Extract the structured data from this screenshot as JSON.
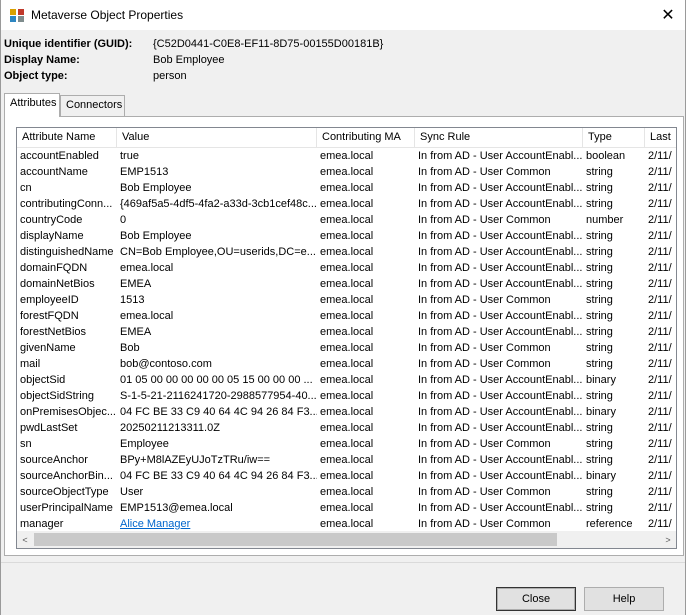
{
  "window": {
    "title": "Metaverse Object Properties",
    "close_glyph": "✕"
  },
  "info": [
    {
      "label": "Unique identifier (GUID):",
      "value": "{C52D0441-C0E8-EF11-8D75-00155D00181B}"
    },
    {
      "label": "Display Name:",
      "value": "Bob Employee"
    },
    {
      "label": "Object type:",
      "value": "person"
    }
  ],
  "tabs": [
    {
      "label": "Attributes",
      "active": true
    },
    {
      "label": "Connectors",
      "active": false
    }
  ],
  "columns": [
    "Attribute Name",
    "Value",
    "Contributing MA",
    "Sync Rule",
    "Type",
    "Last"
  ],
  "rows": [
    [
      "accountEnabled",
      "true",
      "emea.local",
      "In from AD - User AccountEnabl...",
      "boolean",
      "2/11/"
    ],
    [
      "accountName",
      "EMP1513",
      "emea.local",
      "In from AD - User Common",
      "string",
      "2/11/"
    ],
    [
      "cn",
      "Bob Employee",
      "emea.local",
      "In from AD - User AccountEnabl...",
      "string",
      "2/11/"
    ],
    [
      "contributingConn...",
      "{469af5a5-4df5-4fa2-a33d-3cb1cef48c...",
      "emea.local",
      "In from AD - User AccountEnabl...",
      "string",
      "2/11/"
    ],
    [
      "countryCode",
      "0",
      "emea.local",
      "In from AD - User Common",
      "number",
      "2/11/"
    ],
    [
      "displayName",
      "Bob Employee",
      "emea.local",
      "In from AD - User AccountEnabl...",
      "string",
      "2/11/"
    ],
    [
      "distinguishedName",
      "CN=Bob Employee,OU=userids,DC=e...",
      "emea.local",
      "In from AD - User AccountEnabl...",
      "string",
      "2/11/"
    ],
    [
      "domainFQDN",
      "emea.local",
      "emea.local",
      "In from AD - User AccountEnabl...",
      "string",
      "2/11/"
    ],
    [
      "domainNetBios",
      "EMEA",
      "emea.local",
      "In from AD - User AccountEnabl...",
      "string",
      "2/11/"
    ],
    [
      "employeeID",
      "1513",
      "emea.local",
      "In from AD - User Common",
      "string",
      "2/11/"
    ],
    [
      "forestFQDN",
      "emea.local",
      "emea.local",
      "In from AD - User AccountEnabl...",
      "string",
      "2/11/"
    ],
    [
      "forestNetBios",
      "EMEA",
      "emea.local",
      "In from AD - User AccountEnabl...",
      "string",
      "2/11/"
    ],
    [
      "givenName",
      "Bob",
      "emea.local",
      "In from AD - User Common",
      "string",
      "2/11/"
    ],
    [
      "mail",
      "bob@contoso.com",
      "emea.local",
      "In from AD - User Common",
      "string",
      "2/11/"
    ],
    [
      "objectSid",
      "01 05 00 00 00 00 00 05 15 00 00 00 ...",
      "emea.local",
      "In from AD - User AccountEnabl...",
      "binary",
      "2/11/"
    ],
    [
      "objectSidString",
      "S-1-5-21-2116241720-2988577954-40...",
      "emea.local",
      "In from AD - User AccountEnabl...",
      "string",
      "2/11/"
    ],
    [
      "onPremisesObjec...",
      "04 FC BE 33 C9 40 64 4C 94 26 84 F3...",
      "emea.local",
      "In from AD - User AccountEnabl...",
      "binary",
      "2/11/"
    ],
    [
      "pwdLastSet",
      "20250211213311.0Z",
      "emea.local",
      "In from AD - User AccountEnabl...",
      "string",
      "2/11/"
    ],
    [
      "sn",
      "Employee",
      "emea.local",
      "In from AD - User Common",
      "string",
      "2/11/"
    ],
    [
      "sourceAnchor",
      "BPy+M8lAZEyUJoTzTRu/iw==",
      "emea.local",
      "In from AD - User AccountEnabl...",
      "string",
      "2/11/"
    ],
    [
      "sourceAnchorBin...",
      "04 FC BE 33 C9 40 64 4C 94 26 84 F3...",
      "emea.local",
      "In from AD - User AccountEnabl...",
      "binary",
      "2/11/"
    ],
    [
      "sourceObjectType",
      "User",
      "emea.local",
      "In from AD - User Common",
      "string",
      "2/11/"
    ],
    [
      "userPrincipalName",
      "EMP1513@emea.local",
      "emea.local",
      "In from AD - User AccountEnabl...",
      "string",
      "2/11/"
    ],
    [
      "manager",
      "Alice Manager",
      "emea.local",
      "In from AD - User Common",
      "reference",
      "2/11/"
    ]
  ],
  "link_row_index": 23,
  "scroll": {
    "left_glyph": "<",
    "right_glyph": ">"
  },
  "buttons": {
    "close": "Close",
    "help": "Help"
  },
  "colors": {
    "link": "#0066cc",
    "grid_border": "#828790"
  }
}
